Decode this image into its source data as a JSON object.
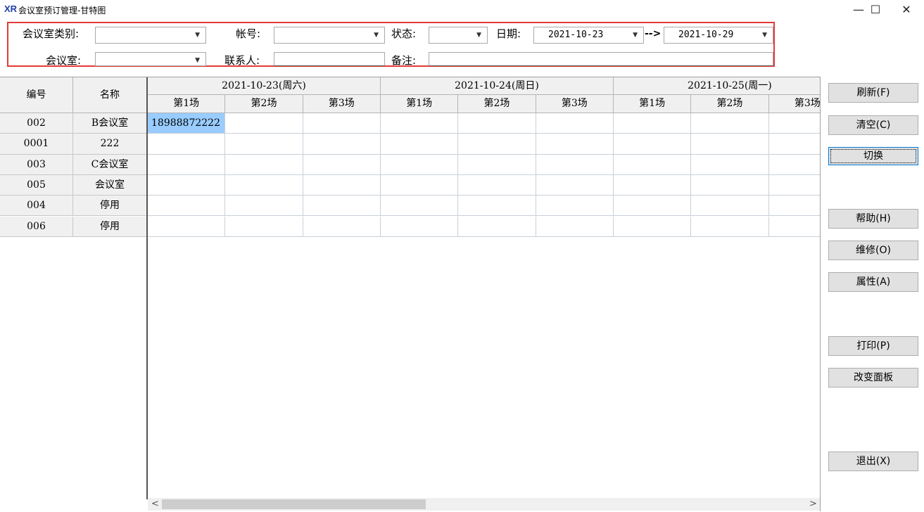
{
  "window": {
    "icon": "XR",
    "title": "会议室预订管理-甘特图",
    "minimize": "—",
    "maximize": "☐",
    "close": "✕"
  },
  "filters": {
    "room_type_label": "会议室类别:",
    "account_label": "帐号:",
    "status_label": "状态:",
    "date_label": "日期:",
    "date_from": "2021-10-23",
    "date_arrow": "-->",
    "date_to": "2021-10-29",
    "room_label": "会议室:",
    "contact_label": "联系人:",
    "remark_label": "备注:",
    "room_type_value": "",
    "account_value": "",
    "status_value": "",
    "room_value": "",
    "contact_value": "",
    "remark_value": ""
  },
  "grid": {
    "col_id": "编号",
    "col_name": "名称",
    "days": [
      {
        "date": "2021-10-23(周六)",
        "sessions": [
          "第1场",
          "第2场",
          "第3场"
        ]
      },
      {
        "date": "2021-10-24(周日)",
        "sessions": [
          "第1场",
          "第2场",
          "第3场"
        ]
      },
      {
        "date": "2021-10-25(周一)",
        "sessions": [
          "第1场",
          "第2场",
          "第3场"
        ]
      }
    ],
    "rows": [
      {
        "id": "002",
        "name": "B会议室",
        "cells": [
          "18988872222",
          "",
          "",
          "",
          "",
          "",
          "",
          "",
          ""
        ]
      },
      {
        "id": "0001",
        "name": "222",
        "cells": [
          "",
          "",
          "",
          "",
          "",
          "",
          "",
          "",
          ""
        ]
      },
      {
        "id": "003",
        "name": "C会议室",
        "cells": [
          "",
          "",
          "",
          "",
          "",
          "",
          "",
          "",
          ""
        ]
      },
      {
        "id": "005",
        "name": "会议室",
        "cells": [
          "",
          "",
          "",
          "",
          "",
          "",
          "",
          "",
          ""
        ]
      },
      {
        "id": "004",
        "name": "停用",
        "cells": [
          "",
          "",
          "",
          "",
          "",
          "",
          "",
          "",
          ""
        ]
      },
      {
        "id": "006",
        "name": "停用",
        "cells": [
          "",
          "",
          "",
          "",
          "",
          "",
          "",
          "",
          ""
        ]
      }
    ]
  },
  "buttons": {
    "refresh": "刷新(F)",
    "clear": "清空(C)",
    "switch": "切换",
    "help": "帮助(H)",
    "repair": "维修(O)",
    "properties": "属性(A)",
    "print": "打印(P)",
    "change_panel": "改变面板",
    "exit": "退出(X)"
  },
  "colors": {
    "selected_cell": "#99ccff",
    "filter_border": "#e53935",
    "focus_border": "#0078d7"
  }
}
